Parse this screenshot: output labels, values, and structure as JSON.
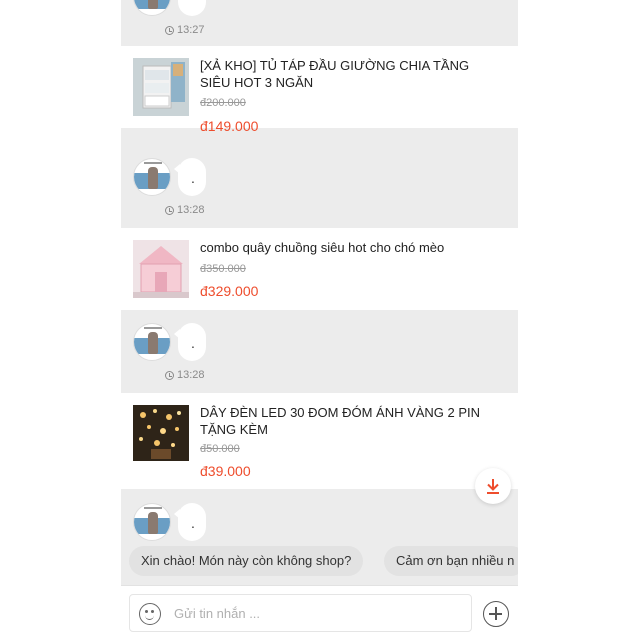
{
  "messages": [
    {
      "type": "time",
      "time": "13:27"
    },
    {
      "type": "product",
      "title": "[XẢ KHO] TỦ TÁP ĐẦU GIƯỜNG CHIA TẦNG SIÊU HOT 3 NGĂN",
      "original_price": "đ200.000",
      "price": "đ149.000",
      "image": "nightstand-thumbnail"
    },
    {
      "type": "text",
      "text": ".",
      "time": "13:28"
    },
    {
      "type": "product",
      "title": "combo quây chuồng siêu hot cho chó mèo",
      "original_price": "đ350.000",
      "price": "đ329.000",
      "image": "pet-playpen-thumbnail"
    },
    {
      "type": "text",
      "text": ".",
      "time": "13:28"
    },
    {
      "type": "product",
      "title": "DÂY ĐÈN LED 30 ĐOM ĐÓM ÁNH VÀNG 2 PIN TẶNG KÈM",
      "original_price": "đ50.000",
      "price": "đ39.000",
      "image": "led-lights-thumbnail"
    },
    {
      "type": "text",
      "text": "."
    }
  ],
  "quick_replies": [
    "Xin chào! Món này còn không shop?",
    "Cảm ơn bạn nhiều n"
  ],
  "composer": {
    "placeholder": "Gửi tin nhắn ..."
  },
  "icons": {
    "emoji": "emoji-icon",
    "add": "plus-circle-icon",
    "scroll_down": "download-arrow-icon",
    "clock": "clock-icon"
  },
  "colors": {
    "accent": "#ee4d2d",
    "background": "#ececec",
    "card": "#ffffff"
  }
}
